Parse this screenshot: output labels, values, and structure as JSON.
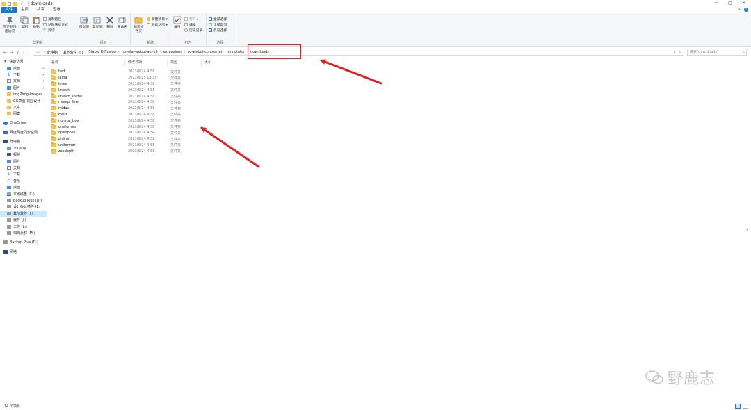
{
  "window": {
    "title": "downloads",
    "controls": {
      "minimize": "─",
      "maximize": "□",
      "close": "✕"
    }
  },
  "ribbon_tabs": [
    "文件",
    "主页",
    "共享",
    "查看"
  ],
  "ribbon": {
    "clipboard": {
      "label": "剪贴板",
      "pin": "固定到快速访问",
      "copy": "复制",
      "paste": "粘贴",
      "cut": "剪切",
      "copy_path": "复制路径",
      "paste_shortcut": "粘贴快捷方式"
    },
    "organize": {
      "label": "组织",
      "move_to": "移动到",
      "copy_to": "复制到",
      "delete": "删除",
      "rename": "重命名"
    },
    "new": {
      "label": "新建",
      "new_item": "新建项目 ▾",
      "easy_access": "轻松访问 ▾",
      "new_folder": "新建文件夹"
    },
    "open": {
      "label": "打开",
      "properties": "属性",
      "open": "打开 ▾",
      "edit": "编辑",
      "history": "历史记录"
    },
    "select": {
      "label": "选择",
      "select_all": "全部选择",
      "select_none": "全部取消",
      "invert": "反向选择"
    }
  },
  "address": {
    "breadcrumbs": [
      "此电脑",
      "其他软件 (I:)",
      "Stable Diffusion",
      "novelai-webui-aki-v3",
      "extensions",
      "sd-webui-controlnet",
      "annotator",
      "downloads"
    ],
    "nav": {
      "back": "←",
      "forward": "→",
      "up_recent": "∨",
      "up": "↑"
    },
    "dropdown": "∨",
    "refresh": "↻"
  },
  "search": {
    "placeholder": "搜索\"downloads\""
  },
  "navpane": {
    "quick_access": "快速访问",
    "quick_items": [
      "桌面",
      "下载",
      "文档",
      "图片",
      "img2img-images",
      "CG草图-花园设计",
      "文章",
      "图案"
    ],
    "onedrive": "OneDrive",
    "baidu": "百度网盘同步空间",
    "this_pc": "此电脑",
    "pc_items": [
      "3D 对象",
      "视频",
      "图片",
      "文档",
      "下载",
      "音乐",
      "桌面",
      "本地磁盘 (C:)",
      "Backup Plus (D:)",
      "设计办公插件 (E:",
      "其他软件 (I:)",
      "缓存 (J:)",
      "工作 (L:)",
      "归档素材 (M:)"
    ],
    "backup": "Backup Plus (D:)",
    "network": "网络"
  },
  "columns": {
    "name": "名称",
    "date": "修改日期",
    "type": "类型",
    "size": "大小"
  },
  "files": [
    {
      "name": "hed",
      "date": "2023/6/24 4:58",
      "type": "文件夹"
    },
    {
      "name": "lama",
      "date": "2023/6/25 18:25",
      "type": "文件夹"
    },
    {
      "name": "leres",
      "date": "2023/6/24 4:58",
      "type": "文件夹"
    },
    {
      "name": "lineart",
      "date": "2023/6/24 4:58",
      "type": "文件夹"
    },
    {
      "name": "lineart_anime",
      "date": "2023/6/24 4:58",
      "type": "文件夹"
    },
    {
      "name": "manga_line",
      "date": "2023/6/24 4:58",
      "type": "文件夹"
    },
    {
      "name": "midas",
      "date": "2023/6/24 4:58",
      "type": "文件夹"
    },
    {
      "name": "mlsd",
      "date": "2023/6/24 4:58",
      "type": "文件夹"
    },
    {
      "name": "normal_bae",
      "date": "2023/6/24 4:58",
      "type": "文件夹"
    },
    {
      "name": "oneformer",
      "date": "2023/6/24 4:58",
      "type": "文件夹"
    },
    {
      "name": "openpose",
      "date": "2023/6/24 4:54",
      "type": "文件夹"
    },
    {
      "name": "pidinet",
      "date": "2023/6/24 4:58",
      "type": "文件夹"
    },
    {
      "name": "uniformer",
      "date": "2023/6/24 4:58",
      "type": "文件夹"
    },
    {
      "name": "zoedepth",
      "date": "2023/6/24 4:58",
      "type": "文件夹"
    }
  ],
  "status": {
    "count": "14 个项目"
  },
  "watermark": {
    "text": "野鹿志"
  },
  "colors": {
    "accent": "#1979ca",
    "highlight": "#e02020",
    "folder": "#f2c14e",
    "selected": "#cce8ff"
  }
}
